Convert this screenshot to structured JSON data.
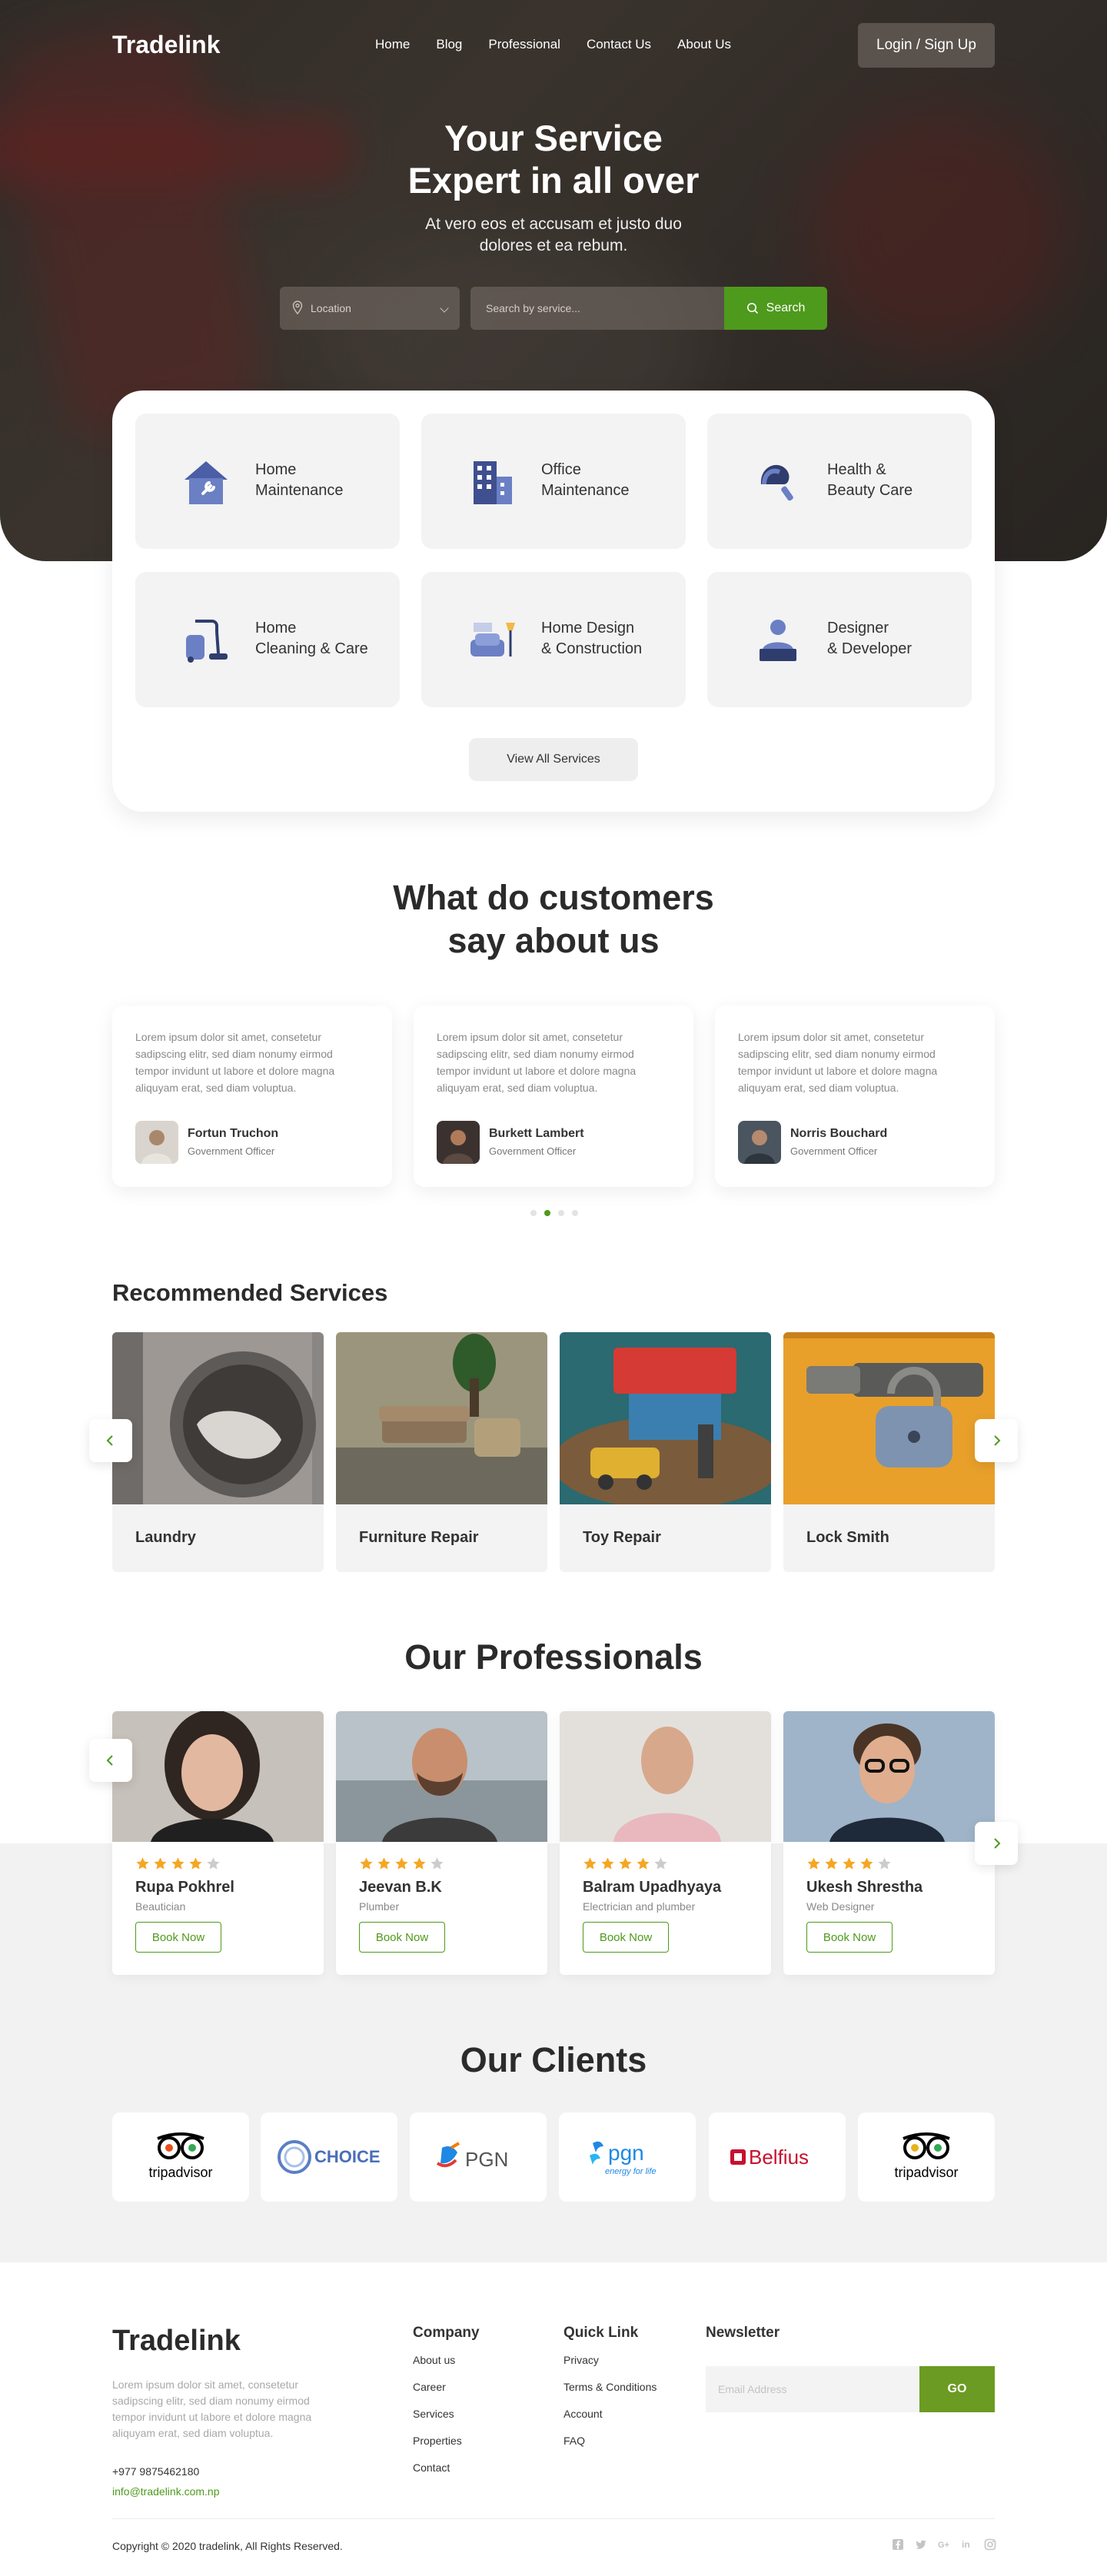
{
  "brand": "Tradelink",
  "nav": {
    "items": [
      "Home",
      "Blog",
      "Professional",
      "Contact Us",
      "About Us"
    ],
    "login_label": "Login / Sign Up"
  },
  "hero": {
    "title_line1": "Your Service",
    "title_line2": "Expert in all over",
    "sub_line1": "At vero eos et accusam et justo duo",
    "sub_line2": "dolores et ea rebum.",
    "location_placeholder": "Location",
    "search_placeholder": "Search by service...",
    "search_label": "Search"
  },
  "services": {
    "items": [
      {
        "label": "Home\nMaintenance",
        "icon": "house-wrench-icon"
      },
      {
        "label": "Office\nMaintenance",
        "icon": "office-building-icon"
      },
      {
        "label": "Health &\nBeauty Care",
        "icon": "hairdryer-icon"
      },
      {
        "label": "Home\nCleaning & Care",
        "icon": "vacuum-cleaner-icon"
      },
      {
        "label": "Home Design\n& Construction",
        "icon": "armchair-lamp-icon"
      },
      {
        "label": "Designer\n& Developer",
        "icon": "developer-laptop-icon"
      }
    ],
    "view_all_label": "View All Services"
  },
  "testimonials": {
    "title_line1": "What do customers",
    "title_line2": "say about us",
    "items": [
      {
        "text": "Lorem ipsum dolor sit amet, consetetur sadipscing elitr, sed diam nonumy eirmod tempor invidunt ut labore et dolore magna aliquyam erat, sed diam voluptua.",
        "name": "Fortun Truchon",
        "role": "Government Officer"
      },
      {
        "text": "Lorem ipsum dolor sit amet, consetetur sadipscing elitr, sed diam nonumy eirmod tempor invidunt ut labore et dolore magna aliquyam erat, sed diam voluptua.",
        "name": "Burkett Lambert",
        "role": "Government Officer"
      },
      {
        "text": "Lorem ipsum dolor sit amet, consetetur sadipscing elitr, sed diam nonumy eirmod tempor invidunt ut labore et dolore magna aliquyam erat, sed diam voluptua.",
        "name": "Norris Bouchard",
        "role": "Government Officer"
      }
    ],
    "active_dot": 1,
    "dot_count": 4
  },
  "recommended": {
    "title": "Recommended Services",
    "items": [
      {
        "label": "Laundry"
      },
      {
        "label": "Furniture Repair"
      },
      {
        "label": "Toy Repair"
      },
      {
        "label": "Lock Smith"
      }
    ]
  },
  "professionals": {
    "title": "Our Professionals",
    "book_label": "Book Now",
    "items": [
      {
        "name": "Rupa Pokhrel",
        "role": "Beautician",
        "rating": 4
      },
      {
        "name": "Jeevan B.K",
        "role": "Plumber",
        "rating": 4
      },
      {
        "name": "Balram Upadhyaya",
        "role": "Electrician and plumber",
        "rating": 4
      },
      {
        "name": "Ukesh Shrestha",
        "role": "Web Designer",
        "rating": 4
      }
    ]
  },
  "clients": {
    "title": "Our Clients",
    "logos": [
      {
        "name": "tripadvisor",
        "text": "tripadvisor"
      },
      {
        "name": "choice",
        "text": "CHOICE"
      },
      {
        "name": "pgn-grey",
        "text": "PGN"
      },
      {
        "name": "pgn-blue",
        "text": "pgn",
        "tagline": "energy for life"
      },
      {
        "name": "belfius",
        "text": "Belfius"
      },
      {
        "name": "tripadvisor-2",
        "text": "tripadvisor"
      }
    ]
  },
  "footer": {
    "brand": "Tradelink",
    "desc": "Lorem ipsum dolor sit amet, consetetur sadipscing elitr, sed diam nonumy eirmod tempor invidunt ut labore et dolore magna aliquyam erat, sed diam voluptua.",
    "phone": "+977 9875462180",
    "email": "info@tradelink.com.np",
    "company": {
      "title": "Company",
      "links": [
        "About us",
        "Career",
        "Services",
        "Properties",
        "Contact"
      ]
    },
    "quick": {
      "title": "Quick Link",
      "links": [
        "Privacy",
        "Terms & Conditions",
        "Account",
        "FAQ"
      ]
    },
    "newsletter": {
      "title": "Newsletter",
      "placeholder": "Email Address",
      "button": "GO"
    },
    "copyright": "Copyright © 2020 tradelink, All Rights Reserved.",
    "socials": [
      "facebook-icon",
      "twitter-icon",
      "google-plus-icon",
      "linkedin-icon",
      "instagram-icon"
    ]
  },
  "colors": {
    "accent": "#4e9a1c",
    "star": "#f5a623",
    "star_off": "#cccccc",
    "icon_blue": "#6b7fc4"
  }
}
